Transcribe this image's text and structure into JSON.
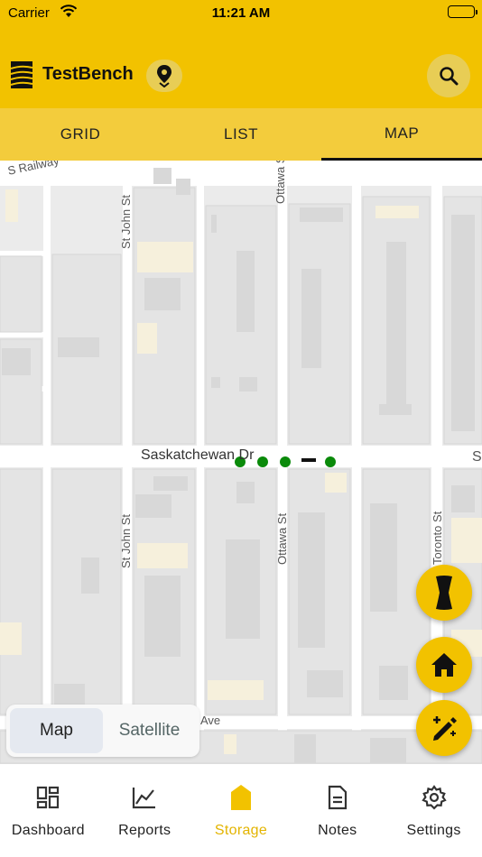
{
  "status": {
    "carrier": "Carrier",
    "time": "11:21 AM"
  },
  "header": {
    "title": "TestBench"
  },
  "tabs": [
    {
      "label": "GRID",
      "active": false
    },
    {
      "label": "LIST",
      "active": false
    },
    {
      "label": "MAP",
      "active": true
    }
  ],
  "map": {
    "streets": {
      "railway": "S Railway",
      "st_john_top": "St John St",
      "ottawa_top": "Ottawa St",
      "saskatchewan": "Saskatchewan Dr",
      "st_john_bottom": "St John St",
      "ottawa_bottom": "Ottawa St",
      "toronto": "Toronto St",
      "avenue": "Ave",
      "s_edge": "S"
    },
    "marker_color": "#0a8a0a",
    "map_type": {
      "options": [
        "Map",
        "Satellite"
      ],
      "selected": "Map"
    }
  },
  "fabs": [
    "phone-icon",
    "home-icon",
    "edit-magic-icon"
  ],
  "nav": [
    {
      "label": "Dashboard",
      "icon": "dashboard-icon",
      "active": false
    },
    {
      "label": "Reports",
      "icon": "chart-icon",
      "active": false
    },
    {
      "label": "Storage",
      "icon": "storage-icon",
      "active": true
    },
    {
      "label": "Notes",
      "icon": "notes-icon",
      "active": false
    },
    {
      "label": "Settings",
      "icon": "gear-icon",
      "active": false
    }
  ],
  "colors": {
    "brand": "#f2c200",
    "tab_bar": "#f3cc3c",
    "active_nav": "#e3b400"
  }
}
